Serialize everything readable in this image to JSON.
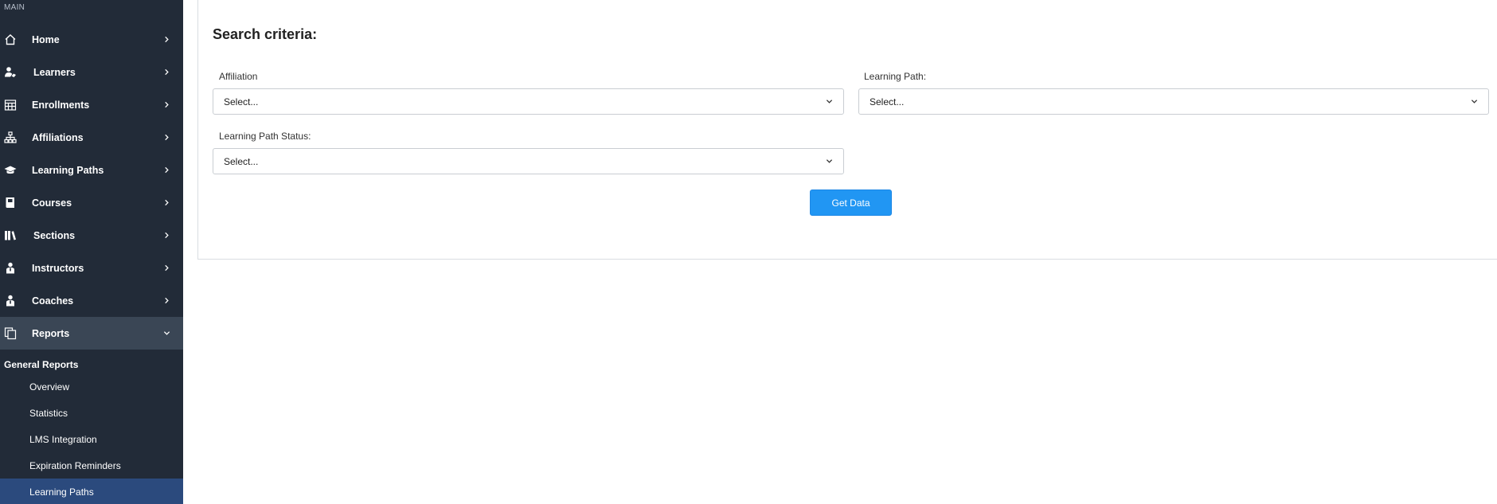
{
  "sidebar": {
    "section_label": "MAIN",
    "items": [
      {
        "label": "Home",
        "icon": "home-icon"
      },
      {
        "label": "Learners",
        "icon": "learners-icon"
      },
      {
        "label": "Enrollments",
        "icon": "calendar-icon"
      },
      {
        "label": "Affiliations",
        "icon": "org-chart-icon"
      },
      {
        "label": "Learning Paths",
        "icon": "graduation-cap-icon"
      },
      {
        "label": "Courses",
        "icon": "book-icon"
      },
      {
        "label": "Sections",
        "icon": "books-shelf-icon"
      },
      {
        "label": "Instructors",
        "icon": "instructor-icon"
      },
      {
        "label": "Coaches",
        "icon": "coach-icon"
      },
      {
        "label": "Reports",
        "icon": "copy-icon",
        "expanded": true
      }
    ],
    "subgroup_title": "General Reports",
    "sub_items": [
      {
        "label": "Overview"
      },
      {
        "label": "Statistics"
      },
      {
        "label": "LMS Integration"
      },
      {
        "label": "Expiration Reminders"
      },
      {
        "label": "Learning Paths",
        "active": true
      }
    ],
    "colors": {
      "background": "#222b38",
      "active_item": "#3a4655",
      "active_sub_item": "#2b4a7d"
    }
  },
  "main": {
    "title": "Search criteria:",
    "fields": {
      "affiliation": {
        "label": "Affiliation",
        "value": "Select..."
      },
      "learning_path": {
        "label": "Learning Path:",
        "value": "Select..."
      },
      "learning_path_status": {
        "label": "Learning Path Status:",
        "value": "Select..."
      }
    },
    "submit_label": "Get Data",
    "colors": {
      "primary_button": "#2196f3"
    }
  }
}
